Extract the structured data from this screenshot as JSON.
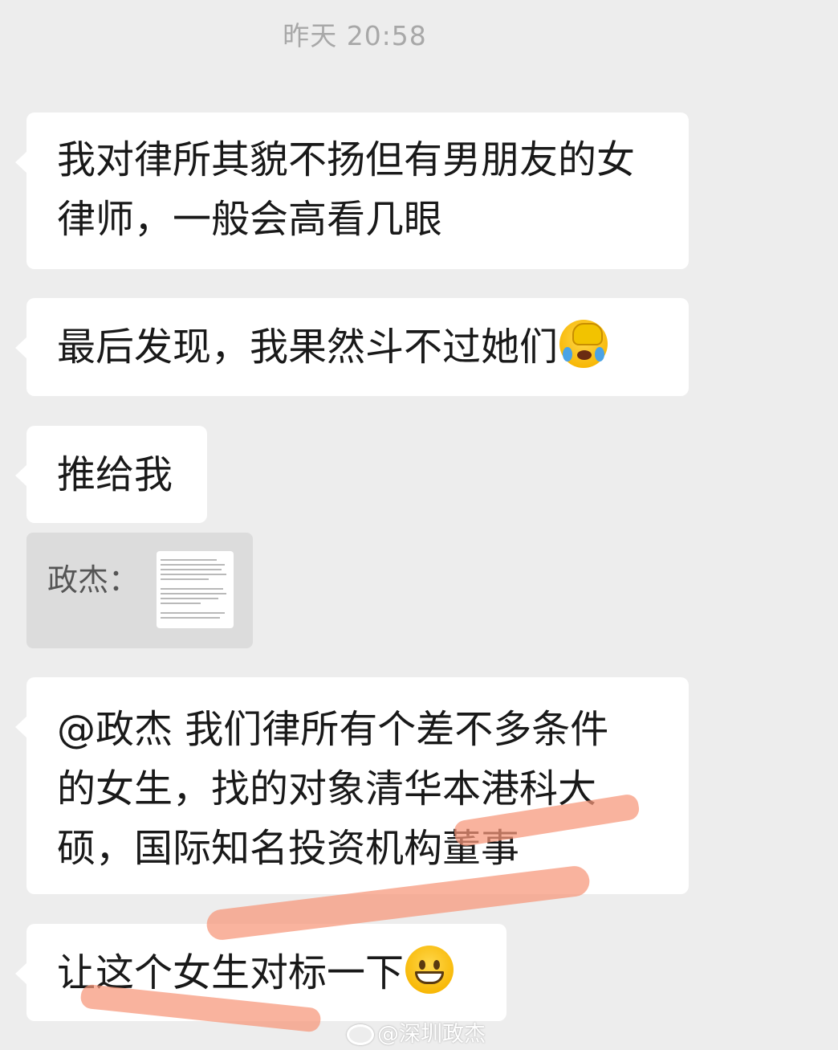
{
  "timestamp": "昨天 20:58",
  "messages": [
    {
      "lines": [
        "我对律所其貌不扬但有男朋友的女",
        "律师，一般会高看几眼"
      ]
    },
    {
      "lines": [
        "最后发现，我果然斗不过她们"
      ],
      "emoji": "facepalm-crying-emoji"
    },
    {
      "lines": [
        "推给我"
      ]
    },
    {
      "sender_label": "政杰：",
      "attachment": "forwarded-chat-record-thumbnail"
    },
    {
      "lines": [
        "@政杰  我们律所有个差不多条件",
        "的女生，找的对象清华本港科大",
        "硕，国际知名投资机构董事"
      ]
    },
    {
      "lines": [
        "让这个女生对标一下"
      ],
      "emoji": "grinning-emoji"
    }
  ],
  "watermark": "@深圳政杰",
  "colors": {
    "background": "#ededed",
    "bubble": "#ffffff",
    "forward_card": "#dcdcdc",
    "highlight_marks": "#f79678"
  }
}
